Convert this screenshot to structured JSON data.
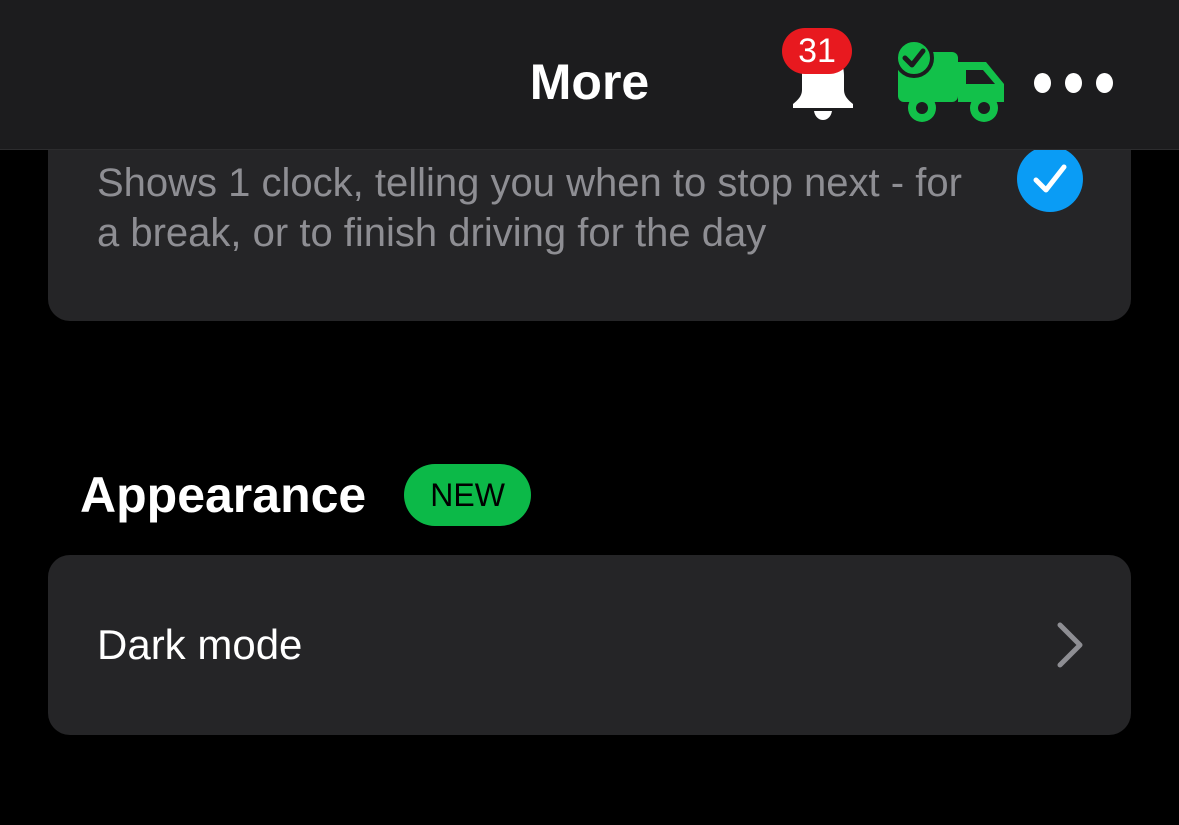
{
  "nav": {
    "title": "More",
    "notification_count": "31",
    "bell_icon": "bell-icon",
    "truck_icon": "truck-check-icon",
    "more_icon": "more-horizontal-icon"
  },
  "top_card": {
    "description": "Shows 1 clock, telling you when to stop next - for a break, or to finish driving for the day",
    "checked": true
  },
  "appearance_section": {
    "title": "Appearance",
    "badge": "NEW",
    "rows": [
      {
        "label": "Dark mode",
        "icon": "chevron-right-icon"
      }
    ]
  },
  "colors": {
    "background": "#000000",
    "card": "#252527",
    "nav_bar": "#1c1c1e",
    "accent_blue": "#0a9cf5",
    "badge_red": "#e8191f",
    "new_green": "#0cb948",
    "truck_green": "#12c14a",
    "secondary_text": "#8e8e93"
  }
}
